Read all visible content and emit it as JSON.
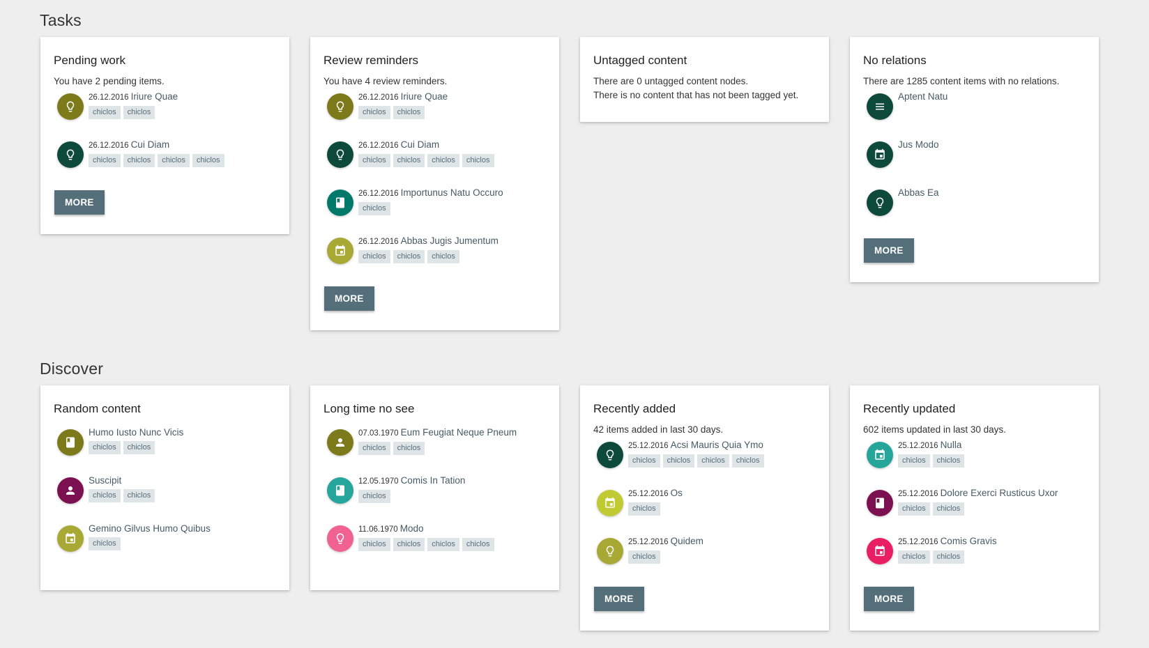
{
  "sections": [
    {
      "title": "Tasks",
      "cards": [
        {
          "title": "Pending work",
          "desc": [
            "You have 2 pending items."
          ],
          "items": [
            {
              "date": "26.12.2016",
              "name": "Iriure Quae",
              "icon": "lightbulb-icon",
              "color": "#7d7a1b",
              "tags": [
                "chiclos",
                "chiclos"
              ]
            },
            {
              "date": "26.12.2016",
              "name": "Cui Diam",
              "icon": "lightbulb-icon",
              "color": "#0d4a3c",
              "tags": [
                "chiclos",
                "chiclos",
                "chiclos",
                "chiclos"
              ]
            }
          ],
          "more": "MORE"
        },
        {
          "title": "Review reminders",
          "desc": [
            "You have 4 review reminders."
          ],
          "items": [
            {
              "date": "26.12.2016",
              "name": "Iriure Quae",
              "icon": "lightbulb-icon",
              "color": "#7d7a1b",
              "tags": [
                "chiclos",
                "chiclos"
              ]
            },
            {
              "date": "26.12.2016",
              "name": "Cui Diam",
              "icon": "lightbulb-icon",
              "color": "#0d4a3c",
              "tags": [
                "chiclos",
                "chiclos",
                "chiclos",
                "chiclos"
              ]
            },
            {
              "date": "26.12.2016",
              "name": "Importunus Natu Occuro",
              "icon": "book-icon",
              "color": "#00796b",
              "tags": [
                "chiclos"
              ]
            },
            {
              "date": "26.12.2016",
              "name": "Abbas Jugis Jumentum",
              "icon": "calendar-icon",
              "color": "#a8a834",
              "tags": [
                "chiclos",
                "chiclos",
                "chiclos"
              ]
            }
          ],
          "more": "MORE"
        },
        {
          "title": "Untagged content",
          "desc": [
            "There are 0 untagged content nodes.",
            "There is no content that has not been tagged yet."
          ],
          "items": [],
          "more": ""
        },
        {
          "title": "No relations",
          "desc": [
            "There are 1285 content items with no relations."
          ],
          "items": [
            {
              "date": "",
              "name": "Aptent Natu",
              "icon": "list-icon",
              "color": "#0d4a3c",
              "tags": []
            },
            {
              "date": "",
              "name": "Jus Modo",
              "icon": "calendar-icon",
              "color": "#0d4a3c",
              "tags": []
            },
            {
              "date": "",
              "name": "Abbas Ea",
              "icon": "lightbulb-icon",
              "color": "#0d4a3c",
              "tags": []
            }
          ],
          "more": "MORE"
        }
      ]
    },
    {
      "title": "Discover",
      "cards": [
        {
          "title": "Random content",
          "desc": [],
          "items": [
            {
              "date": "",
              "name": "Humo Iusto Nunc Vicis",
              "icon": "book-icon",
              "color": "#7d7a1b",
              "tags": [
                "chiclos",
                "chiclos"
              ]
            },
            {
              "date": "",
              "name": "Suscipit",
              "icon": "person-icon",
              "color": "#7b1150",
              "tags": [
                "chiclos",
                "chiclos"
              ]
            },
            {
              "date": "",
              "name": "Gemino Gilvus Humo Quibus",
              "icon": "calendar-icon",
              "color": "#a8a834",
              "tags": [
                "chiclos"
              ]
            }
          ],
          "more": ""
        },
        {
          "title": "Long time no see",
          "desc": [],
          "items": [
            {
              "date": "07.03.1970",
              "name": "Eum Feugiat Neque Pneum",
              "icon": "person-icon",
              "color": "#7d7a1b",
              "tags": [
                "chiclos",
                "chiclos"
              ]
            },
            {
              "date": "12.05.1970",
              "name": "Comis In Tation",
              "icon": "book-icon",
              "color": "#26a69a",
              "tags": [
                "chiclos"
              ]
            },
            {
              "date": "11.06.1970",
              "name": "Modo",
              "icon": "lightbulb-icon",
              "color": "#f06292",
              "tags": [
                "chiclos",
                "chiclos",
                "chiclos",
                "chiclos"
              ]
            }
          ],
          "more": ""
        },
        {
          "title": "Recently added",
          "desc": [
            "42 items added in last 30 days."
          ],
          "items": [
            {
              "date": "25.12.2016",
              "name": "Acsi Mauris Quia Ymo",
              "icon": "lightbulb-icon",
              "color": "#0d4a3c",
              "tags": [
                "chiclos",
                "chiclos",
                "chiclos",
                "chiclos"
              ]
            },
            {
              "date": "25.12.2016",
              "name": "Os",
              "icon": "calendar-icon",
              "color": "#c0ca33",
              "tags": [
                "chiclos"
              ]
            },
            {
              "date": "25.12.2016",
              "name": "Quidem",
              "icon": "lightbulb-icon",
              "color": "#a8a834",
              "tags": [
                "chiclos"
              ]
            }
          ],
          "more": "MORE"
        },
        {
          "title": "Recently updated",
          "desc": [
            "602 items updated in last 30 days."
          ],
          "items": [
            {
              "date": "25.12.2016",
              "name": "Nulla",
              "icon": "calendar-icon",
              "color": "#26a69a",
              "tags": [
                "chiclos",
                "chiclos"
              ]
            },
            {
              "date": "25.12.2016",
              "name": "Dolore Exerci Rusticus Uxor",
              "icon": "book-icon",
              "color": "#7b1150",
              "tags": [
                "chiclos",
                "chiclos"
              ]
            },
            {
              "date": "25.12.2016",
              "name": "Comis Gravis",
              "icon": "calendar-icon",
              "color": "#e91e63",
              "tags": [
                "chiclos",
                "chiclos"
              ]
            }
          ],
          "more": "MORE"
        }
      ]
    }
  ]
}
